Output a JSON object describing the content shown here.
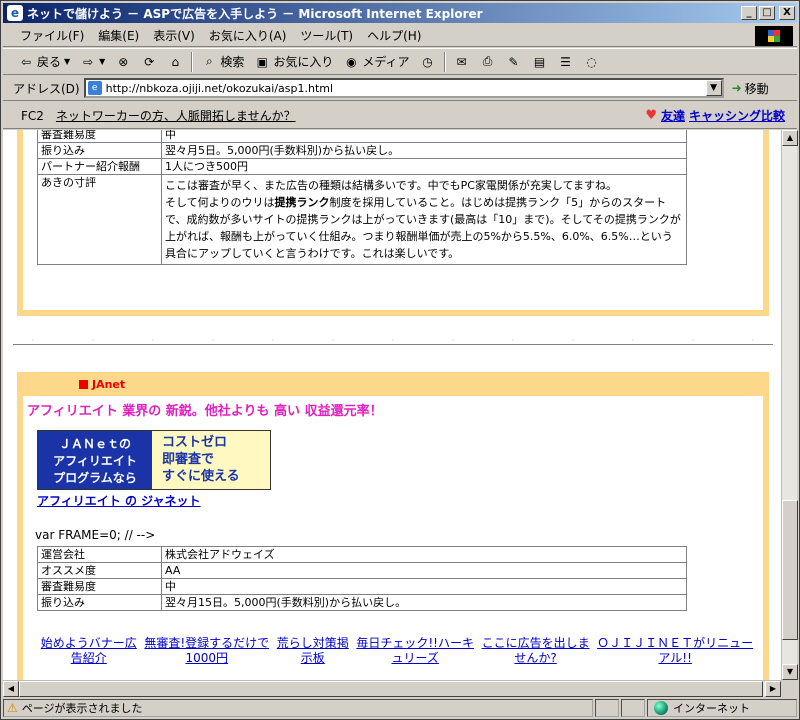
{
  "window": {
    "title": "ネットで儲けよう － ASPで広告を入手しよう － Microsoft Internet Explorer",
    "minimize": "_",
    "maximize": "□",
    "close": "X"
  },
  "menu": [
    "ファイル(F)",
    "編集(E)",
    "表示(V)",
    "お気に入り(A)",
    "ツール(T)",
    "ヘルプ(H)"
  ],
  "toolbar": {
    "back_label": "戻る",
    "search_label": "検索",
    "favorites_label": "お気に入り",
    "media_label": "メディア"
  },
  "address": {
    "label": "アドレス(D)",
    "url": "http://nbkoza.ojiji.net/okozukai/asp1.html",
    "go_label": "移動"
  },
  "fc2bar": {
    "brand": "FC2",
    "link": "ネットワーカーの方、人脈開拓しませんか？",
    "friend_link": "友達",
    "cashing_link": "キャッシング比較"
  },
  "table1": {
    "rows": [
      {
        "key": "審査難易度",
        "value": "中"
      },
      {
        "key": "振り込み",
        "value": "翌々月5日。5,000円(手数料別)から払い戻し。"
      },
      {
        "key": "パートナー紹介報酬",
        "value": "1人につき500円"
      }
    ],
    "review_key": "あきの寸評",
    "review_p1": "ここは審査が早く、また広告の種類は結構多いです。中でもPC家電関係が充実してますね。",
    "review_p2a": "そして何よりのウリは",
    "review_p2b": "提携ランク",
    "review_p2c": "制度を採用していること。はじめは提携ランク「5」からのスタートで、成約数が多いサイトの提携ランクは上がっていきます(最高は「10」まで)。そしてその提携ランクが上がれば、報酬も上がっていく仕組み。つまり報酬単価が売上の5%から5.5%、6.0%、6.5%…という具合にアップしていくと言うわけです。これは楽しいです。"
  },
  "janet": {
    "heading": "JAnet",
    "catch": "アフィリエイト 業界の 新鋭。他社よりも 高い 収益還元率！",
    "banner_left": [
      "ＪＡＮｅｔの",
      "アフィリエイト",
      "プログラムなら"
    ],
    "banner_right": [
      "コストゼロ",
      "即審査で",
      "すぐに使える"
    ],
    "link": "アフィリエイト の ジャネット",
    "varline": "var FRAME=0; // -->"
  },
  "table2": {
    "rows": [
      {
        "key": "運営会社",
        "value": "株式会社アドウェイズ"
      },
      {
        "key": "オススメ度",
        "value": "AA"
      },
      {
        "key": "審査難易度",
        "value": "中"
      },
      {
        "key": "振り込み",
        "value": "翌々月15日。5,000円(手数料別)から払い戻し。"
      }
    ]
  },
  "footer_links": [
    [
      "始めようバナー広",
      "告紹介"
    ],
    [
      "無審査!登録するだけで",
      "1000円"
    ],
    [
      "荒らし対策掲",
      "示板"
    ],
    [
      "毎日チェック!!ハーキ",
      "ュリーズ"
    ],
    [
      "ここに広告を出しま",
      "せんか?"
    ],
    [
      "ＯＪＩＪＩＮＥＴがリニュー",
      "アル!!"
    ]
  ],
  "status": {
    "text": "ページが表示されました",
    "zone": "インターネット"
  }
}
